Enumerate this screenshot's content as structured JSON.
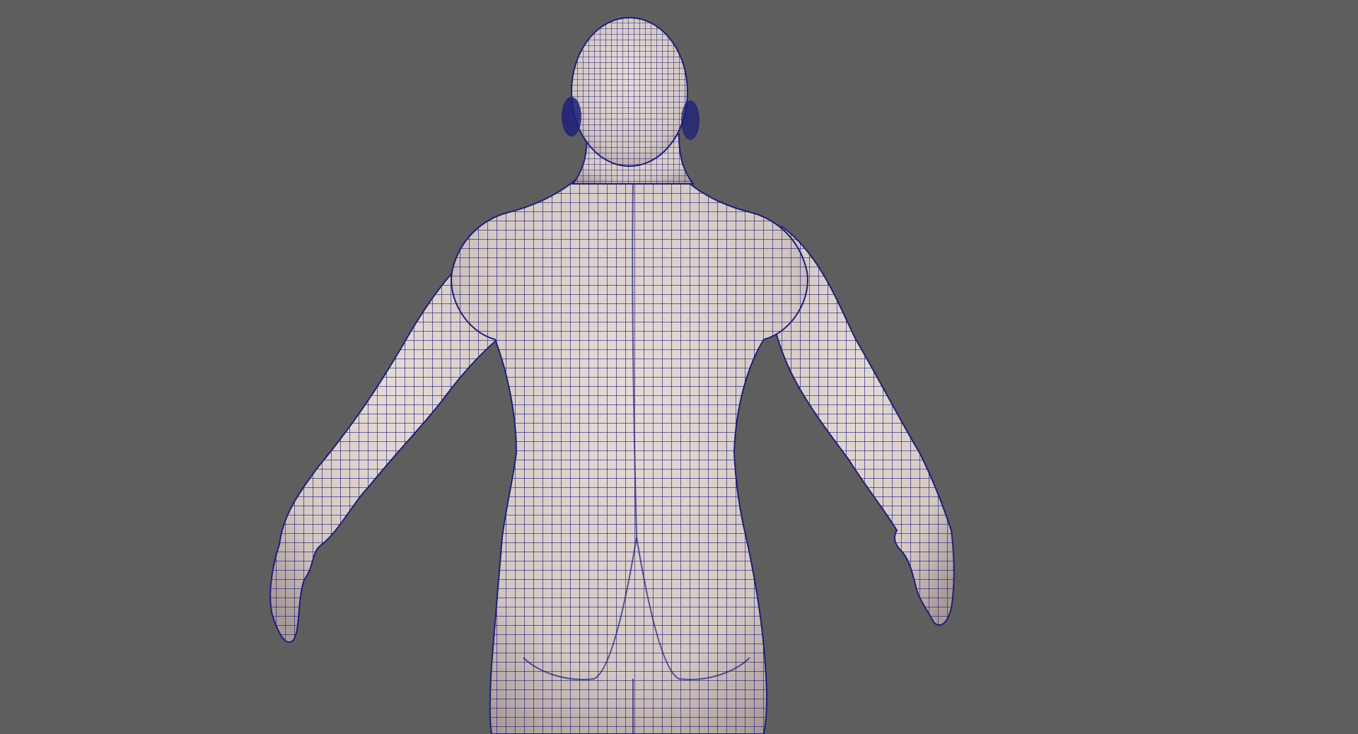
{
  "viewport": {
    "background": "#5e5e5e",
    "object": "character-mesh-back-view",
    "display_mode": "wireframe-on-shaded",
    "skin_color": "#d9cfca",
    "wire_color": "#1e1e7a",
    "shadow_color": "#b9aaa6"
  }
}
